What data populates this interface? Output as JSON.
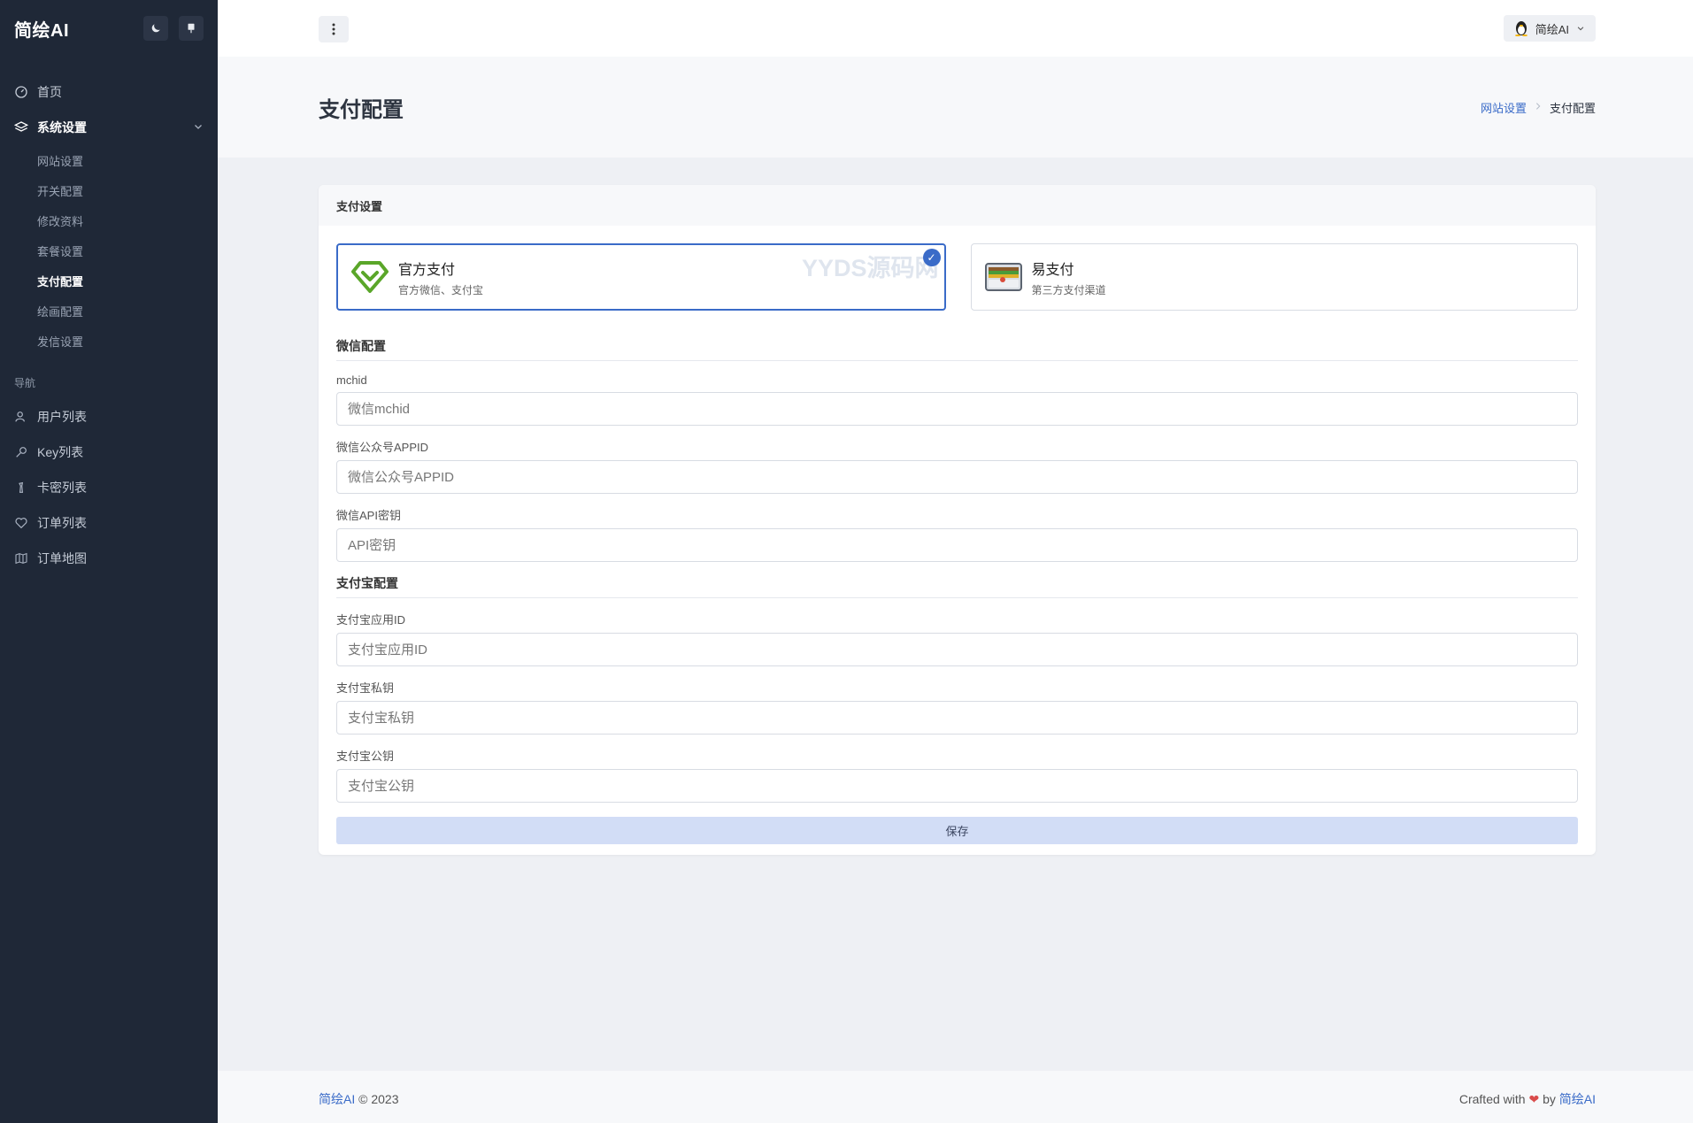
{
  "app": {
    "logo": "简绘AI"
  },
  "sidebar": {
    "theme_icon": "moon-icon",
    "pin_icon": "pin-icon",
    "home": {
      "label": "首页",
      "icon": "dashboard-icon"
    },
    "system": {
      "label": "系统设置",
      "icon": "layers-icon",
      "children": [
        "网站设置",
        "开关配置",
        "修改资料",
        "套餐设置",
        "支付配置",
        "绘画配置",
        "发信设置"
      ],
      "active": "支付配置"
    },
    "nav_heading": "导航",
    "nav_items": [
      {
        "label": "用户列表",
        "icon": "users-icon"
      },
      {
        "label": "Key列表",
        "icon": "key-icon"
      },
      {
        "label": "卡密列表",
        "icon": "chess-icon"
      },
      {
        "label": "订单列表",
        "icon": "heart-icon"
      },
      {
        "label": "订单地图",
        "icon": "map-icon"
      }
    ]
  },
  "header": {
    "menu_icon": "more-vertical-icon",
    "user": {
      "name": "简绘AI",
      "avatar_icon": "penguin-avatar-icon"
    }
  },
  "page": {
    "title": "支付配置",
    "breadcrumb": {
      "parent": "网站设置",
      "current": "支付配置"
    }
  },
  "card": {
    "title": "支付设置",
    "options": [
      {
        "title": "官方支付",
        "desc": "官方微信、支付宝",
        "selected": true,
        "icon": "diamond-check-icon"
      },
      {
        "title": "易支付",
        "desc": "第三方支付渠道",
        "selected": false,
        "icon": "wallet-icon"
      }
    ],
    "watermark": "YYDS源码网",
    "wechat": {
      "section": "微信配置",
      "fields": [
        {
          "label": "mchid",
          "placeholder": "微信mchid",
          "value": ""
        },
        {
          "label": "微信公众号APPID",
          "placeholder": "微信公众号APPID",
          "value": ""
        },
        {
          "label": "微信API密钥",
          "placeholder": "API密钥",
          "value": ""
        }
      ]
    },
    "alipay": {
      "section": "支付宝配置",
      "fields": [
        {
          "label": "支付宝应用ID",
          "placeholder": "支付宝应用ID",
          "value": ""
        },
        {
          "label": "支付宝私钥",
          "placeholder": "支付宝私钥",
          "value": ""
        },
        {
          "label": "支付宝公钥",
          "placeholder": "支付宝公钥",
          "value": ""
        }
      ]
    },
    "save_label": "保存"
  },
  "footer": {
    "brand": "简绘AI",
    "copyright": "© 2023",
    "crafted": "Crafted with",
    "by": "by",
    "author": "简绘AI"
  },
  "colors": {
    "sidebar_bg": "#1f2837",
    "accent": "#3a6bc8",
    "save_bg": "#d2ddf6",
    "heart": "#d94b4b"
  }
}
